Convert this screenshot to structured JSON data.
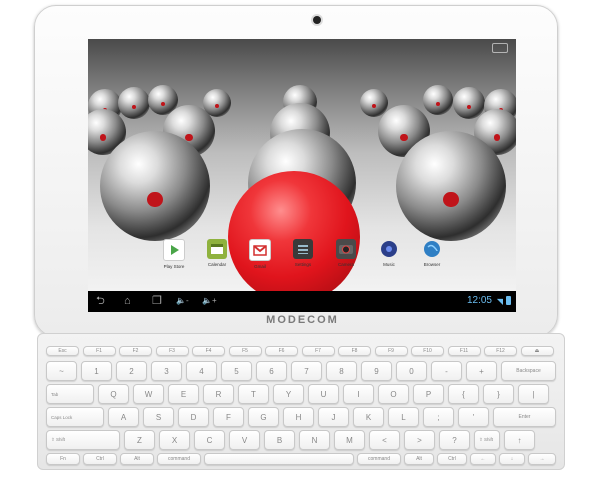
{
  "device": {
    "brand": "MODECOM"
  },
  "screen": {
    "apps": [
      {
        "label": "Play Store",
        "icon": "play-store-icon",
        "color": "#ffffff"
      },
      {
        "label": "Calendar",
        "icon": "calendar-icon",
        "color": "#8fb23e"
      },
      {
        "label": "Gmail",
        "icon": "gmail-icon",
        "color": "#ffffff"
      },
      {
        "label": "Settings",
        "icon": "settings-icon",
        "color": "#3a3a3a"
      },
      {
        "label": "Camera",
        "icon": "camera-icon",
        "color": "#4a4a4a"
      },
      {
        "label": "Music",
        "icon": "music-icon",
        "color": "#2b3f8a"
      },
      {
        "label": "Browser",
        "icon": "browser-icon",
        "color": "#2f7fc4"
      }
    ],
    "navbar": {
      "back": "⮌",
      "home": "⌂",
      "recents": "❐",
      "vol_down": "🔈-",
      "vol_up": "🔈+",
      "time": "12:05",
      "accent": "#6bbdf0"
    }
  },
  "keyboard": {
    "fn_row": [
      "Esc",
      "F1",
      "F2",
      "F3",
      "F4",
      "F5",
      "F6",
      "F7",
      "F8",
      "F9",
      "F10",
      "F11",
      "F12",
      "⏏"
    ],
    "row1": [
      "~",
      "1",
      "2",
      "3",
      "4",
      "5",
      "6",
      "7",
      "8",
      "9",
      "0",
      "-",
      "+"
    ],
    "backspace": "Backspace",
    "tab": "Tab",
    "row2": [
      "Q",
      "W",
      "E",
      "R",
      "T",
      "Y",
      "U",
      "I",
      "O",
      "P",
      "{",
      "}",
      "|"
    ],
    "caps": "Caps Lock",
    "row3": [
      "A",
      "S",
      "D",
      "F",
      "G",
      "H",
      "J",
      "K",
      "L",
      ";",
      "'"
    ],
    "enter": "Enter",
    "shift_l": "⇧ Shift",
    "row4": [
      "Z",
      "X",
      "C",
      "V",
      "B",
      "N",
      "M",
      "<",
      ">",
      "?"
    ],
    "shift_r": "⇧ Shift",
    "arrow_up": "↑",
    "fn": "Fn",
    "ctrl": "Ctrl",
    "alt": "Alt",
    "command": "command",
    "command_r": "command",
    "alt_r": "Alt",
    "ctrl_r": "Ctrl",
    "arrows": [
      "←",
      "↓",
      "→"
    ]
  }
}
